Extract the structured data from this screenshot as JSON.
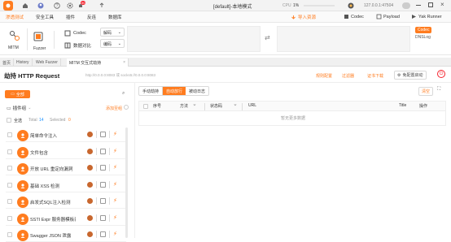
{
  "titlebar": {
    "window_title": "[default]-本地模式",
    "cpu_label": "CPU",
    "cpu_value": "1%",
    "address": "127.0.0.1:47504",
    "badge_count": "50"
  },
  "menubar": {
    "items": [
      "渗透测试",
      "安全工具",
      "插件",
      "反连",
      "数据库"
    ],
    "import_resource": "导入资源",
    "codec": "Codec",
    "payload": "Payload",
    "yak_runner": "Yak Runner"
  },
  "tools": {
    "mitm": "MITM",
    "fuzzer": "Fuzzer",
    "codec": "Codec",
    "compare": "数据对比",
    "decode_label": "解码",
    "encode_label": "编码",
    "right_codec": "Codec",
    "right_dnslog": "DNSLog"
  },
  "tabs": [
    "首页",
    "History",
    "Web Fuzzer",
    "MITM 交互式劫持"
  ],
  "hijack": {
    "title": "劫持 HTTP Request",
    "listen": "http://0.0.0.0:8083 或 socks5://0.0.0.0:8083",
    "config": "规则配置",
    "filter": "过滤器",
    "cert": "证书下载",
    "passive": "免配置启动"
  },
  "plugins": {
    "all_label": "全部",
    "group_label": "插件组",
    "add_group": "添加至组",
    "select_all": "全选",
    "total_label": "Total",
    "total_value": "14",
    "selected_label": "Selected",
    "selected_value": "0",
    "items": [
      "简单命令注入",
      "文件包含",
      "开放 URL 重定向漏洞",
      "基础 XSS 检测",
      "启发式SQL注入检测",
      "SSTI Expr 服务器模板表达…",
      "Swagger JSON 泄露"
    ]
  },
  "right": {
    "modes": [
      "手动劫持",
      "自动放行",
      "被动日志"
    ],
    "clear": "清空",
    "columns": [
      "序号",
      "方法",
      "状态码",
      "URL",
      "Title",
      "操作"
    ],
    "empty_text": "暂无更多数据"
  }
}
